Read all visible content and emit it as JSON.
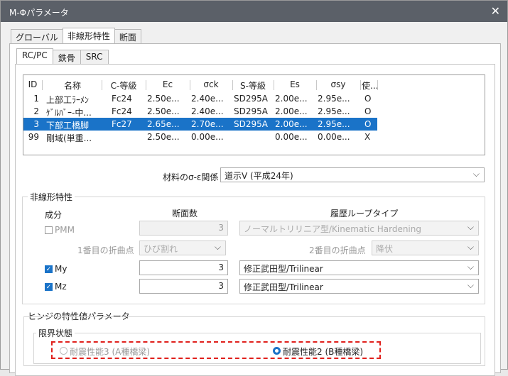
{
  "window": {
    "title": "M-Φパラメータ",
    "close": "✕"
  },
  "main_tabs": [
    "グローバル",
    "非線形特性",
    "断面"
  ],
  "sub_tabs": [
    "RC/PC",
    "鉄骨",
    "SRC"
  ],
  "table": {
    "headers": [
      "ID",
      "名称",
      "C-等級",
      "Ec",
      "σck",
      "S-等級",
      "Es",
      "σsy",
      "使..."
    ],
    "rows": [
      [
        "1",
        "上部工ﾗｰﾒﾝ",
        "Fc24",
        "2.50e...",
        "2.40e...",
        "SD295A",
        "2.00e...",
        "2.95e...",
        "O"
      ],
      [
        "2",
        "ｹﾞﾙﾊﾞｰ-中...",
        "Fc24",
        "2.50e...",
        "2.40e...",
        "SD295A",
        "2.00e...",
        "2.95e...",
        "O"
      ],
      [
        "3",
        "下部工橋脚",
        "Fc27",
        "2.65e...",
        "2.70e...",
        "SD295A",
        "2.00e...",
        "2.95e...",
        "O"
      ],
      [
        "99",
        "剛域(単重...",
        "",
        "2.50e...",
        "0.00e...",
        "",
        "0.00e...",
        "0.00e...",
        "X"
      ]
    ],
    "selected_row": 3
  },
  "material": {
    "label": "材料のσ-ε関係",
    "value": "道示V (平成24年)"
  },
  "nonlinear": {
    "title": "非線形特性",
    "col_component": "成分",
    "col_sections": "断面数",
    "col_hysteresis": "履歴ループタイプ",
    "pmm": {
      "label": "PMM",
      "value": "3",
      "type": "ノーマルトリリニア型/Kinematic Hardening"
    },
    "bend1": {
      "label": "1番目の折曲点",
      "value": "ひび割れ"
    },
    "bend2": {
      "label": "2番目の折曲点",
      "value": "降伏"
    },
    "my": {
      "label": "My",
      "value": "3",
      "type": "修正武田型/Trilinear"
    },
    "mz": {
      "label": "Mz",
      "value": "3",
      "type": "修正武田型/Trilinear"
    }
  },
  "hinge": {
    "title": "ヒンジの特性値パラメータ",
    "limit_title": "限界状態",
    "opt1": "耐震性能3 (A種橋梁)",
    "opt2": "耐震性能2 (B種橋梁)"
  },
  "icons": {
    "chevron": "chevron-down-icon",
    "check": "✓"
  }
}
